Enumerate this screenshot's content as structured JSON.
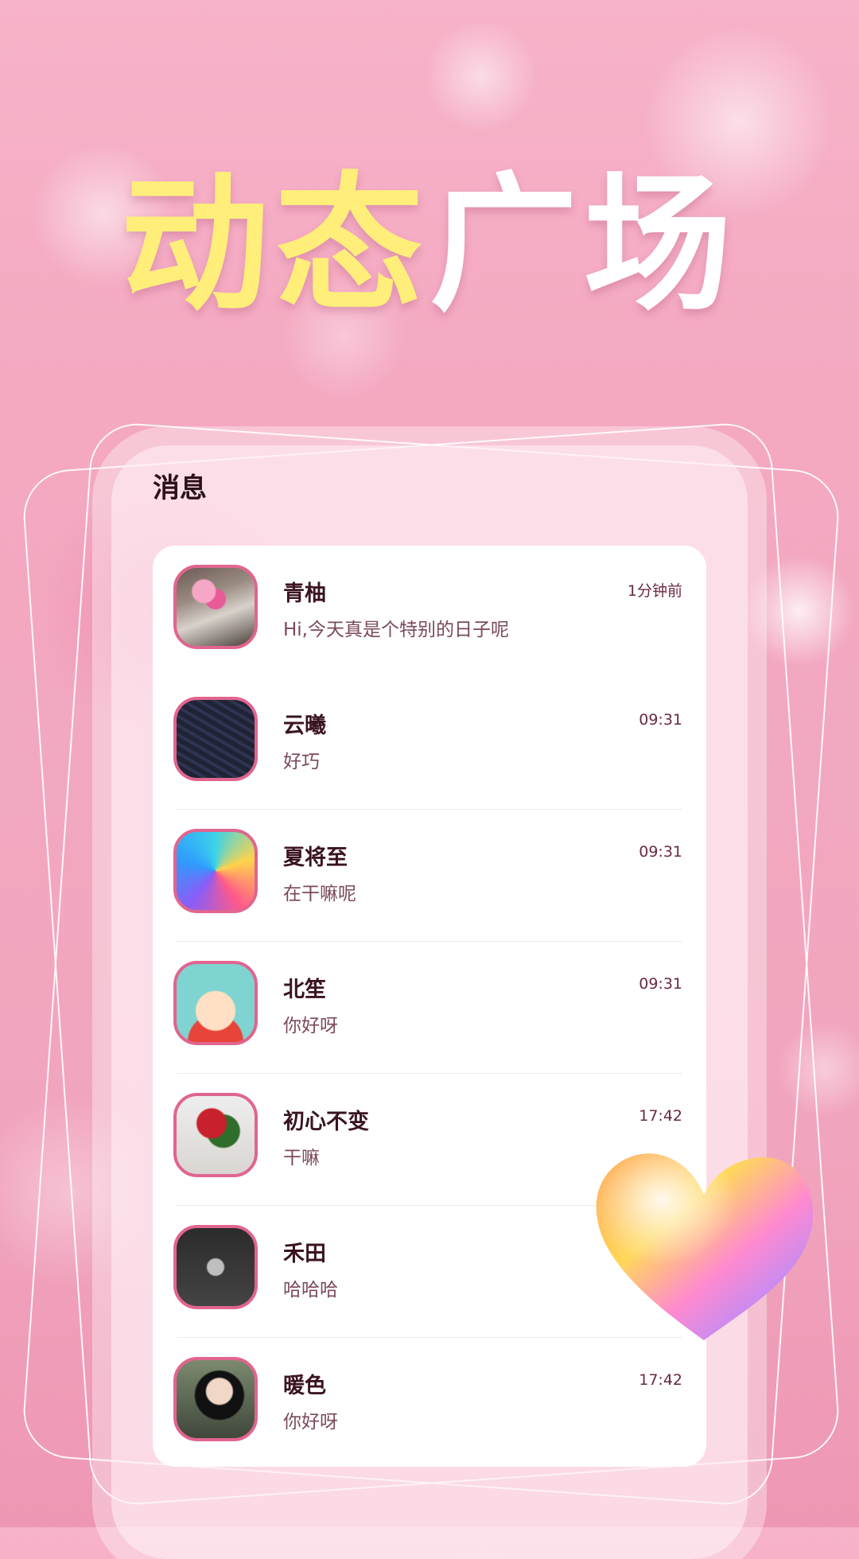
{
  "hero": {
    "part1": "动态",
    "part2": "广场"
  },
  "screen_title": "消息",
  "conversations": [
    {
      "name": "青柚",
      "message": "Hi,今天真是个特别的日子呢",
      "time": "1分钟前",
      "avatar": "flowers-photo-avatar"
    },
    {
      "name": "云曦",
      "message": "好巧",
      "time": "09:31",
      "avatar": "dark-fabric-avatar"
    },
    {
      "name": "夏将至",
      "message": "在干嘛呢",
      "time": "09:31",
      "avatar": "colorful-bird-avatar"
    },
    {
      "name": "北笙",
      "message": "你好呀",
      "time": "09:31",
      "avatar": "cartoon-boy-avatar"
    },
    {
      "name": "初心不变",
      "message": "干嘛",
      "time": "17:42",
      "avatar": "roses-vase-avatar"
    },
    {
      "name": "禾田",
      "message": "哈哈哈",
      "time": "",
      "avatar": "i-love-u-avatar"
    },
    {
      "name": "暖色",
      "message": "你好呀",
      "time": "17:42",
      "avatar": "woman-selfie-avatar"
    }
  ],
  "colors": {
    "accent": "#e0658f",
    "title_yellow": "#ffef7a",
    "background": "#f4a9c1"
  }
}
